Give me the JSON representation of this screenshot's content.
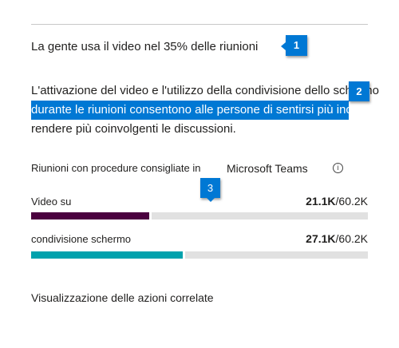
{
  "headline": "La gente usa il video nel 35% delle riunioni",
  "paragraph": {
    "line1": "L'attivazione del video e l'utilizzo della condivisione dello schermo",
    "line2": "durante le riunioni consentono alle persone di sentirsi più incluse e",
    "line3": "rendere più coinvolgenti le discussioni."
  },
  "badges": [
    "1",
    "2",
    "3"
  ],
  "section": {
    "label": "Riunioni con procedure consigliate in",
    "product": "Microsoft Teams",
    "info_icon": "info-icon"
  },
  "metrics": [
    {
      "label": "Video su",
      "value": "21.1K",
      "total": "/60.2K",
      "fraction": 0.35,
      "color": "#4b003f"
    },
    {
      "label": "condivisione schermo",
      "value": "27.1K",
      "total": "/60.2K",
      "fraction": 0.45,
      "color": "#00a2ad"
    }
  ],
  "footer_link": "Visualizzazione delle azioni correlate"
}
